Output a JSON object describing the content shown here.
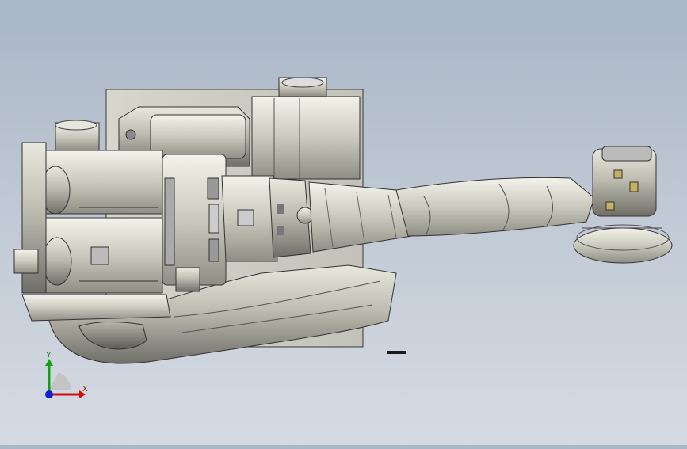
{
  "viewport": {
    "background_top": "#a9b6c6",
    "background_bottom": "#d5dbe3",
    "model": "robot-arm-assembly"
  },
  "triad": {
    "x_label": "X",
    "y_label": "Y",
    "x_color": "#d01010",
    "y_color": "#10a010",
    "z_color": "#1020d0"
  }
}
